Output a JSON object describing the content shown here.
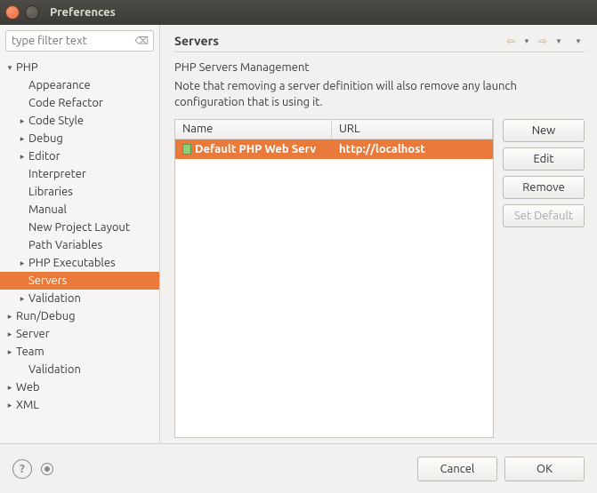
{
  "window": {
    "title": "Preferences"
  },
  "filter": {
    "placeholder": "type filter text"
  },
  "tree": [
    {
      "label": "PHP",
      "depth": 0,
      "twisty": "▾"
    },
    {
      "label": "Appearance",
      "depth": 1,
      "twisty": ""
    },
    {
      "label": "Code Refactor",
      "depth": 1,
      "twisty": ""
    },
    {
      "label": "Code Style",
      "depth": 1,
      "twisty": "▸"
    },
    {
      "label": "Debug",
      "depth": 1,
      "twisty": "▸"
    },
    {
      "label": "Editor",
      "depth": 1,
      "twisty": "▸"
    },
    {
      "label": "Interpreter",
      "depth": 1,
      "twisty": ""
    },
    {
      "label": "Libraries",
      "depth": 1,
      "twisty": ""
    },
    {
      "label": "Manual",
      "depth": 1,
      "twisty": ""
    },
    {
      "label": "New Project Layout",
      "depth": 1,
      "twisty": ""
    },
    {
      "label": "Path Variables",
      "depth": 1,
      "twisty": ""
    },
    {
      "label": "PHP Executables",
      "depth": 1,
      "twisty": "▸"
    },
    {
      "label": "Servers",
      "depth": 1,
      "twisty": "",
      "selected": true
    },
    {
      "label": "Validation",
      "depth": 1,
      "twisty": "▸"
    },
    {
      "label": "Run/Debug",
      "depth": 0,
      "twisty": "▸"
    },
    {
      "label": "Server",
      "depth": 0,
      "twisty": "▸"
    },
    {
      "label": "Team",
      "depth": 0,
      "twisty": "▸"
    },
    {
      "label": "Validation",
      "depth": 1,
      "twisty": ""
    },
    {
      "label": "Web",
      "depth": 0,
      "twisty": "▸"
    },
    {
      "label": "XML",
      "depth": 0,
      "twisty": "▸"
    }
  ],
  "page": {
    "title": "Servers",
    "description": "PHP Servers Management",
    "note": "Note that removing a server definition will also remove any launch configuration that is using it."
  },
  "table": {
    "columns": {
      "name": "Name",
      "url": "URL"
    },
    "rows": [
      {
        "name": "Default PHP Web Serv",
        "url": "http://localhost",
        "selected": true
      }
    ]
  },
  "buttons": {
    "new": "New",
    "edit": "Edit",
    "remove": "Remove",
    "setDefault": "Set Default"
  },
  "footer": {
    "cancel": "Cancel",
    "ok": "OK"
  }
}
